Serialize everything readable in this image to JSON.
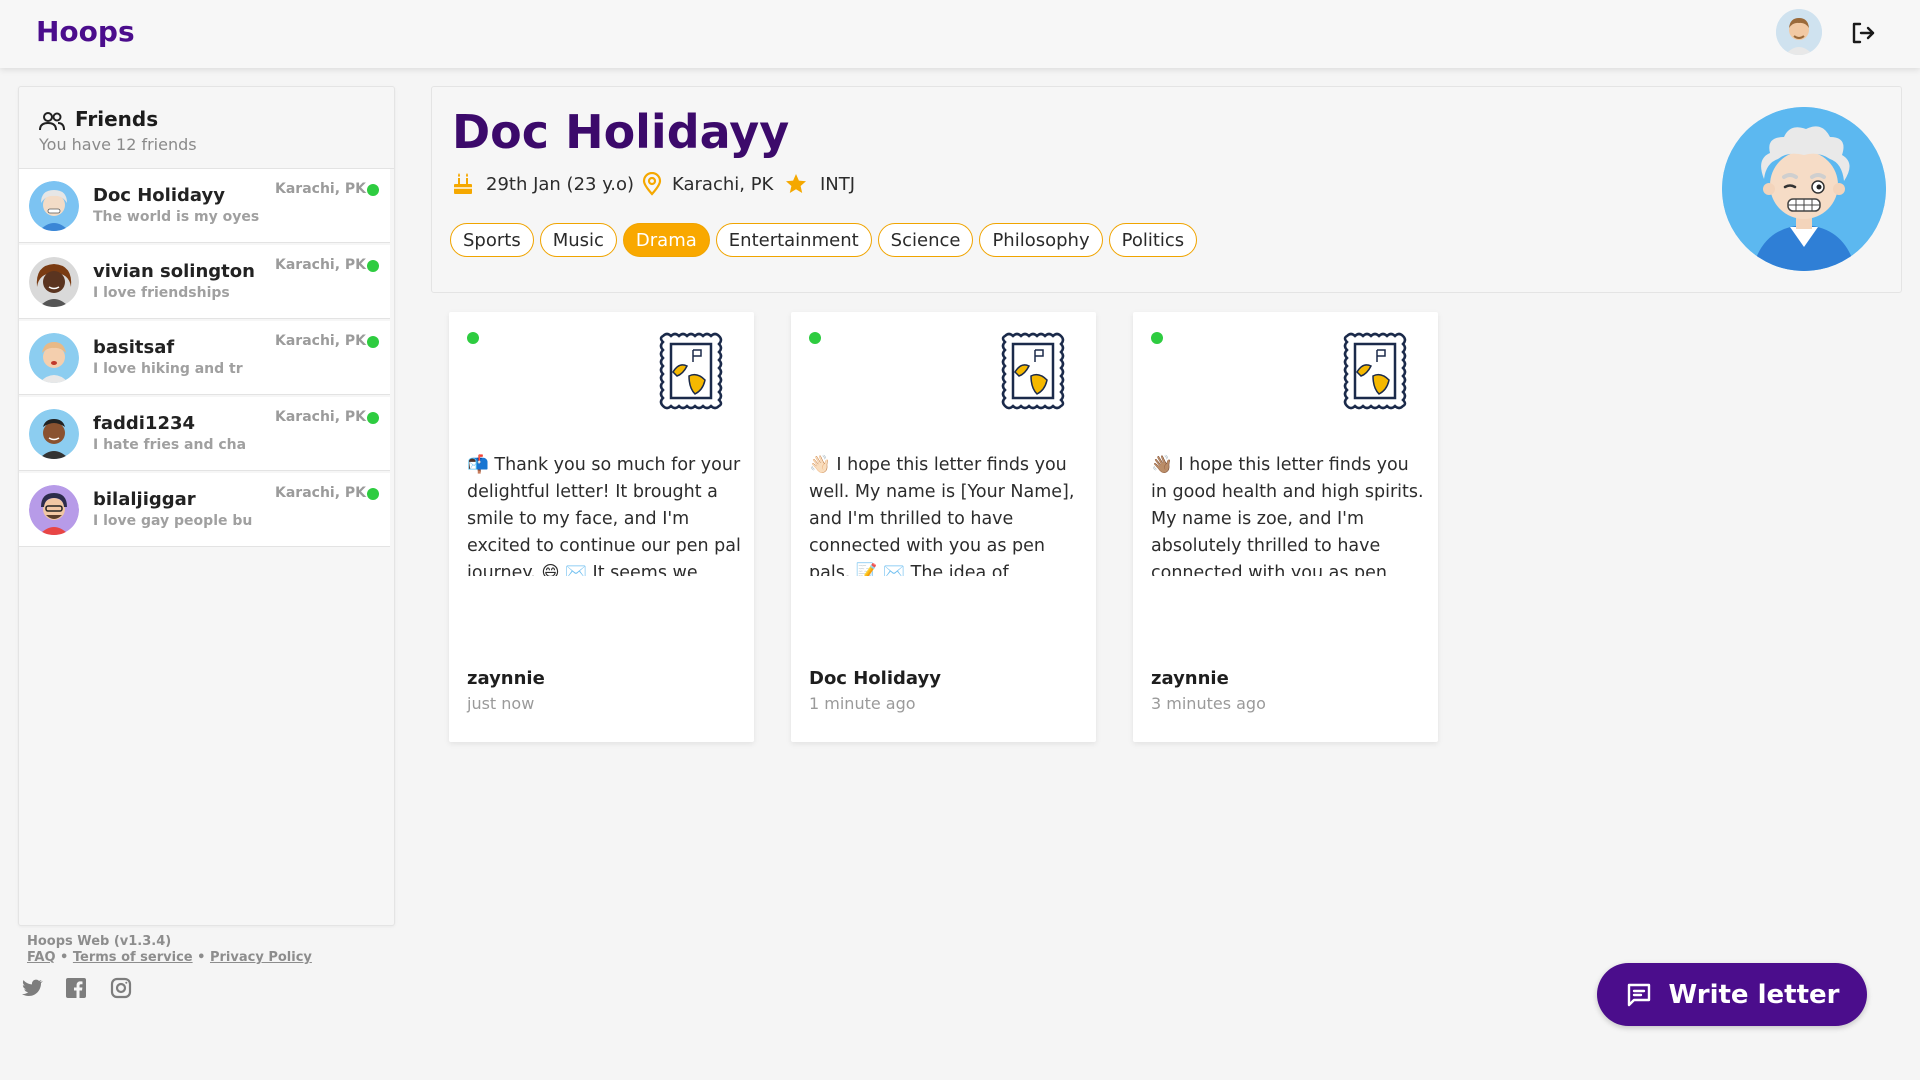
{
  "app": {
    "brand": "Hoops"
  },
  "sidebar": {
    "title": "Friends",
    "subtitle": "You have 12 friends",
    "friends": [
      {
        "name": "Doc Holidayy",
        "status": "The world is my oyes",
        "location": "Karachi, PK",
        "online": true
      },
      {
        "name": "vivian solington",
        "status": "I love friendships",
        "location": "Karachi, PK",
        "online": true
      },
      {
        "name": "basitsaf",
        "status": "I love hiking and tr",
        "location": "Karachi, PK",
        "online": true
      },
      {
        "name": "faddi1234",
        "status": "I hate fries and cha",
        "location": "Karachi, PK",
        "online": true
      },
      {
        "name": "bilaljiggar",
        "status": "I love gay people bu",
        "location": "Karachi, PK",
        "online": true
      }
    ]
  },
  "footer": {
    "version": "Hoops Web (v1.3.4)",
    "faq": "FAQ",
    "sep": "•",
    "terms": "Terms of service",
    "privacy": "Privacy Policy",
    "social": [
      "twitter-icon",
      "facebook-icon",
      "instagram-icon"
    ]
  },
  "profile": {
    "name": "Doc Holidayy",
    "birthday": "29th Jan (23 y.o)",
    "location": "Karachi, PK",
    "personality": "INTJ",
    "interests": [
      "Sports",
      "Music",
      "Drama",
      "Entertainment",
      "Science",
      "Philosophy",
      "Politics"
    ],
    "active_interest": "Drama"
  },
  "letters": [
    {
      "emoji": "📬",
      "text": "Thank you so much for your delightful letter! It brought a smile to my face, and I'm excited to continue our pen pal journey. 😄 ✉️ It seems we have some wonderful common interests.",
      "from": "zaynnie",
      "time": "just now"
    },
    {
      "emoji": "👋🏻",
      "text": "I hope this letter finds you well. My name is [Your Name], and I'm thrilled to have connected with you as pen pals. 📝 ✉️ The idea of exchanging letters and forming a meaningful",
      "from": "Doc Holidayy",
      "time": "1 minute ago"
    },
    {
      "emoji": "👋🏽",
      "text": "I hope this letter finds you in good health and high spirits. My name is zoe, and I'm absolutely thrilled to have connected with you as pen pals. 🎉 The idea of exchanging letters and",
      "from": "zaynnie",
      "time": "3 minutes ago"
    }
  ],
  "actions": {
    "write_letter": "Write letter"
  },
  "colors": {
    "brand": "#4b0d8c",
    "accent": "#f9a800",
    "online": "#2ecc40"
  }
}
